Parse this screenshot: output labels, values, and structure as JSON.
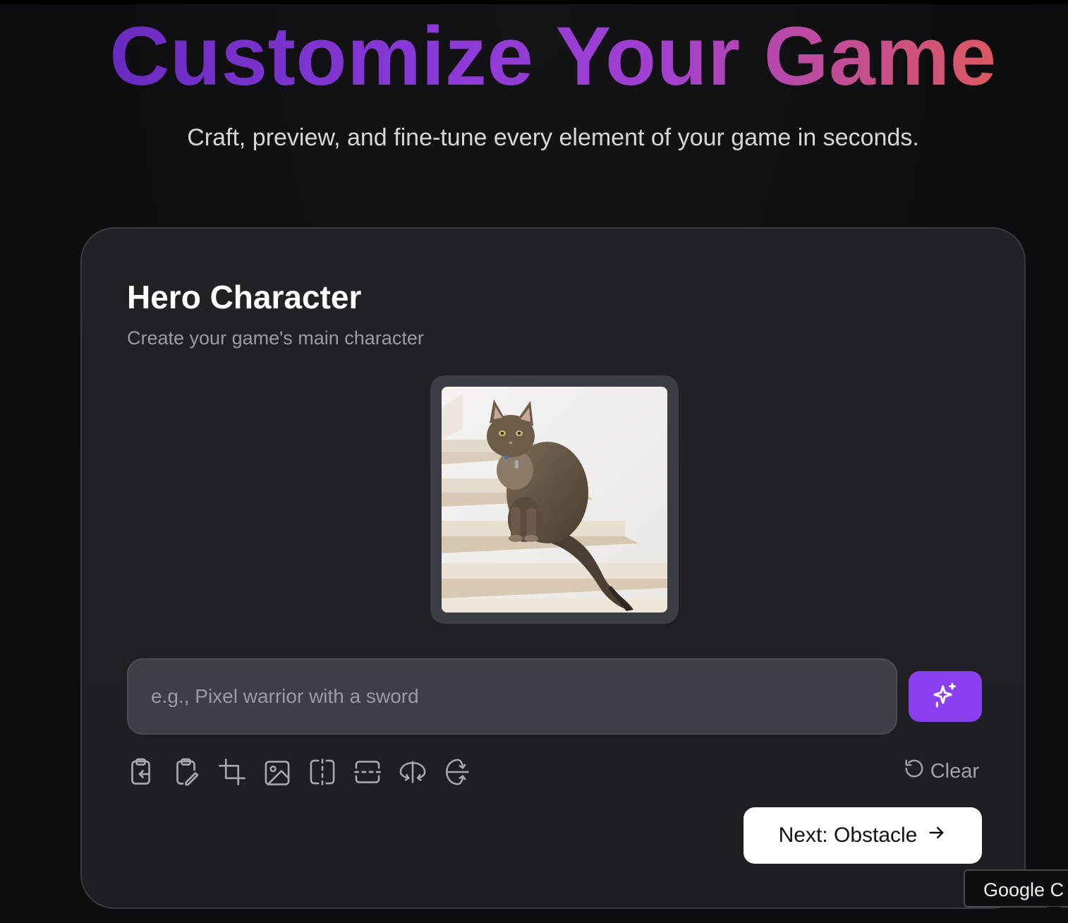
{
  "header": {
    "title": "Customize Your Game",
    "subtitle": "Craft, preview, and fine-tune every element of your game in seconds."
  },
  "card": {
    "title": "Hero Character",
    "subtitle": "Create your game's main character",
    "preview_alt": "cat-sitting-on-stairs",
    "prompt": {
      "value": "",
      "placeholder": "e.g., Pixel warrior with a sword"
    },
    "generate_icon": "sparkles-icon",
    "tools": [
      "paste-icon",
      "clipboard-edit-icon",
      "crop-icon",
      "image-icon",
      "flip-vertical-split-icon",
      "flip-horizontal-split-icon",
      "rotate-horizontal-icon",
      "rotate-vertical-icon"
    ],
    "clear_label": "Clear",
    "next_label": "Next: Obstacle"
  },
  "tooltip": {
    "text": "Google C"
  },
  "colors": {
    "accent": "#8a3ff0",
    "title_gradient": [
      "#6a2bc0",
      "#8b3ad9",
      "#e05a5a"
    ],
    "card_bg": "#1f1f23",
    "page_bg": "#101012"
  }
}
